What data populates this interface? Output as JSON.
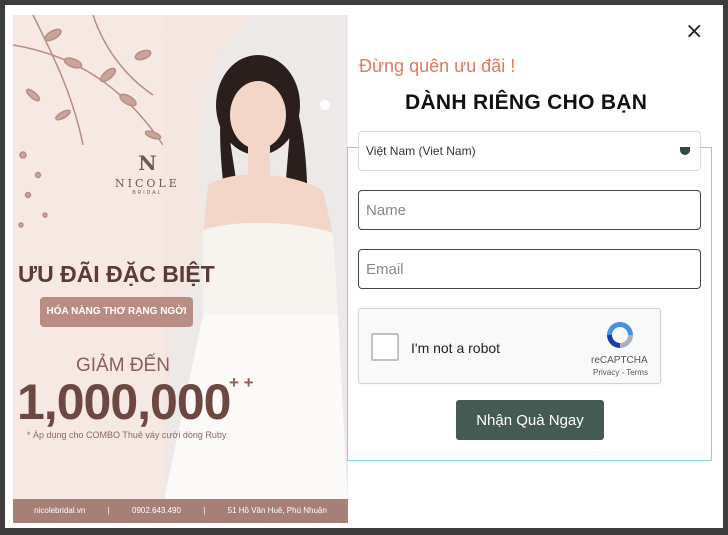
{
  "popup": {
    "close_label": "×",
    "subtitle": "Đừng quên ưu đãi !",
    "title": "DÀNH RIÊNG CHO BẠN"
  },
  "banner": {
    "logo_mark": "N",
    "logo_name": "NICOLE",
    "logo_sub": "BRIDAL",
    "promo_title": "ƯU ĐÃI ĐẶC BIỆT",
    "promo_pill": "HÓA NÀNG THƠ RẠNG NGỜI",
    "discount_label": "GIẢM ĐẾN",
    "discount_amount": "1,000,000",
    "discount_plus": "+ +",
    "note": "* Áp dụng cho COMBO Thuê váy cưới dòng Ruby",
    "footer": {
      "website": "nicolebridal.vn",
      "phone": "0902.643.490",
      "address": "51 Hồ Văn Huê, Phú Nhuận"
    }
  },
  "form": {
    "country_value": "Việt Nam (Viet Nam)",
    "name_placeholder": "Name",
    "email_placeholder": "Email",
    "recaptcha": {
      "label": "I'm not a robot",
      "brand": "reCAPTCHA",
      "links": "Privacy - Terms"
    },
    "submit_label": "Nhận Quà Ngay"
  },
  "colors": {
    "accent_subtitle": "#e07a5f",
    "submit_bg": "#465a54",
    "frame_border": "#7fd3de",
    "banner_bg": "#f6e8e2"
  }
}
